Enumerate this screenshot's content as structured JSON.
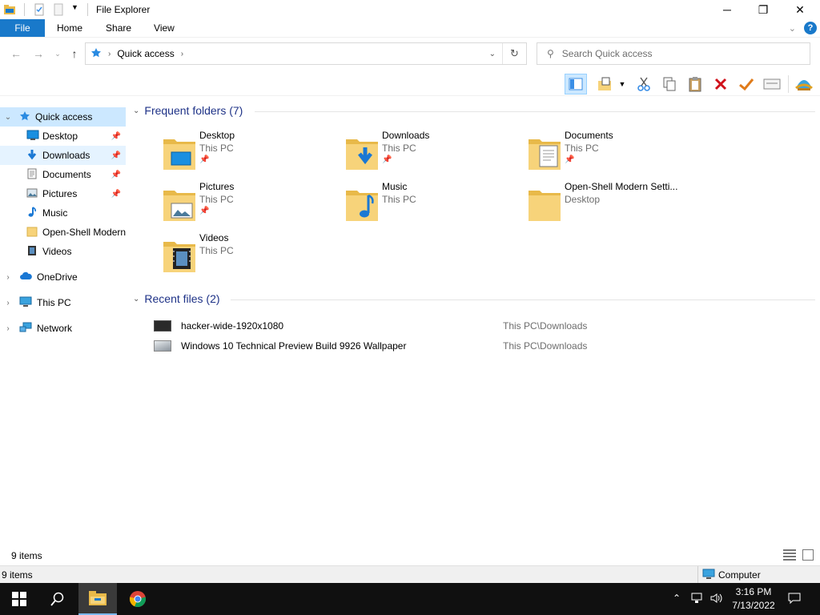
{
  "window": {
    "title": "File Explorer",
    "controls": {
      "minimize": "─",
      "restore": "❐",
      "close": "✕"
    }
  },
  "ribbon": {
    "tabs": [
      {
        "label": "File",
        "active": true
      },
      {
        "label": "Home"
      },
      {
        "label": "Share"
      },
      {
        "label": "View"
      }
    ],
    "help": "?"
  },
  "address": {
    "crumbs": [
      "Quick access"
    ],
    "search_placeholder": "Search Quick access"
  },
  "nav": {
    "items": [
      {
        "label": "Quick access",
        "icon": "star-icon",
        "level": 0,
        "expanded": true,
        "selected": true
      },
      {
        "label": "Desktop",
        "icon": "desktop-icon",
        "level": 1,
        "pinned": true
      },
      {
        "label": "Downloads",
        "icon": "downloads-icon",
        "level": 1,
        "pinned": true,
        "hover": true
      },
      {
        "label": "Documents",
        "icon": "documents-icon",
        "level": 1,
        "pinned": true
      },
      {
        "label": "Pictures",
        "icon": "pictures-icon",
        "level": 1,
        "pinned": true
      },
      {
        "label": "Music",
        "icon": "music-icon",
        "level": 1
      },
      {
        "label": "Open-Shell Modern",
        "icon": "folder-icon",
        "level": 1
      },
      {
        "label": "Videos",
        "icon": "videos-icon",
        "level": 1
      },
      {
        "label": "OneDrive",
        "icon": "cloud-icon",
        "level": 0
      },
      {
        "label": "This PC",
        "icon": "computer-icon",
        "level": 0
      },
      {
        "label": "Network",
        "icon": "network-icon",
        "level": 0
      }
    ]
  },
  "content": {
    "frequent_header": "Frequent folders (7)",
    "recent_header": "Recent files (2)",
    "folders": [
      {
        "name": "Desktop",
        "location": "This PC",
        "pinned": true,
        "overlay": "desktop"
      },
      {
        "name": "Downloads",
        "location": "This PC",
        "pinned": true,
        "overlay": "downloads"
      },
      {
        "name": "Documents",
        "location": "This PC",
        "pinned": true,
        "overlay": "documents"
      },
      {
        "name": "Pictures",
        "location": "This PC",
        "pinned": true,
        "overlay": "pictures"
      },
      {
        "name": "Music",
        "location": "This PC",
        "pinned": false,
        "overlay": "music"
      },
      {
        "name": "Open-Shell Modern Setti...",
        "location": "Desktop",
        "pinned": false,
        "overlay": "none"
      },
      {
        "name": "Videos",
        "location": "This PC",
        "pinned": false,
        "overlay": "videos"
      }
    ],
    "recent_files": [
      {
        "name": "hacker-wide-1920x1080",
        "path": "This PC\\Downloads",
        "thumb": "#2a2a2a"
      },
      {
        "name": "Windows 10 Technical Preview Build 9926 Wallpaper",
        "path": "This PC\\Downloads",
        "thumb": "#9aa3ad"
      }
    ]
  },
  "status": {
    "items_count": "9 items",
    "details_count": "9 items",
    "computer_label": "Computer"
  },
  "taskbar": {
    "time": "3:16 PM",
    "date": "7/13/2022"
  },
  "colors": {
    "accent": "#1979ca",
    "folder": "#f7d37a",
    "folder_dark": "#e8b949",
    "header_text": "#1e3287",
    "selection": "#cce8ff"
  }
}
